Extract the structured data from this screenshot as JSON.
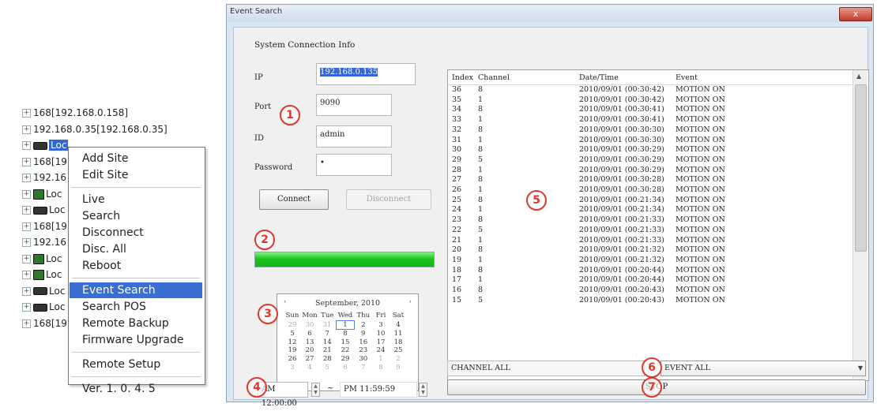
{
  "tree": {
    "items": [
      {
        "label": "168[192.168.0.158]",
        "icon": "none"
      },
      {
        "label": "192.168.0.35[192.168.0.35]",
        "icon": "none"
      },
      {
        "label": "Loc",
        "icon": "dvr"
      },
      {
        "label": "168[19",
        "icon": "none"
      },
      {
        "label": "192.16",
        "icon": "none"
      },
      {
        "label": "Loc",
        "icon": "server"
      },
      {
        "label": "Loc",
        "icon": "dvr"
      },
      {
        "label": "168[19",
        "icon": "none"
      },
      {
        "label": "192.16",
        "icon": "none"
      },
      {
        "label": "Loc",
        "icon": "server"
      },
      {
        "label": "Loc",
        "icon": "server"
      },
      {
        "label": "Loc",
        "icon": "dvr"
      },
      {
        "label": "Loc",
        "icon": "dvr"
      },
      {
        "label": "168[19",
        "icon": "none"
      }
    ]
  },
  "context_menu": {
    "group1": [
      "Add Site",
      "Edit Site"
    ],
    "group2": [
      "Live",
      "Search",
      "Disconnect",
      "Disc. All",
      "Reboot"
    ],
    "group3": [
      "Event Search",
      "Search POS",
      "Remote Backup",
      "Firmware Upgrade"
    ],
    "group4": [
      "Remote Setup"
    ],
    "group5": [
      "Ver. 1. 0. 4. 5"
    ],
    "highlighted": "Event Search"
  },
  "window": {
    "title": "Event Search",
    "close_glyph": "x"
  },
  "connection": {
    "section_title": "System Connection Info",
    "ip_label": "IP",
    "ip_value": "192.168.0.135",
    "port_label": "Port",
    "port_value": "9090",
    "id_label": "ID",
    "id_value": "admin",
    "password_label": "Password",
    "password_value": "•",
    "connect_label": "Connect",
    "disconnect_label": "Disconnect"
  },
  "progress": {
    "fraction": 1.0
  },
  "calendar": {
    "month_title": "September, 2010",
    "prev_glyph": "‹",
    "next_glyph": "›",
    "weekdays": [
      "Sun",
      "Mon",
      "Tue",
      "Wed",
      "Thu",
      "Fri",
      "Sat"
    ],
    "weeks": [
      [
        "29",
        "30",
        "31",
        "1",
        "2",
        "3",
        "4"
      ],
      [
        "5",
        "6",
        "7",
        "8",
        "9",
        "10",
        "11"
      ],
      [
        "12",
        "13",
        "14",
        "15",
        "16",
        "17",
        "18"
      ],
      [
        "19",
        "20",
        "21",
        "22",
        "23",
        "24",
        "25"
      ],
      [
        "26",
        "27",
        "28",
        "29",
        "30",
        "1",
        "2"
      ],
      [
        "3",
        "4",
        "5",
        "6",
        "7",
        "8",
        "9"
      ]
    ]
  },
  "time_range": {
    "start": "AM 12:00:00",
    "separator": "~",
    "end": "PM 11:59:59"
  },
  "event_list": {
    "columns": [
      "Index",
      "Channel",
      "Date/Time",
      "Event"
    ],
    "rows": [
      [
        "36",
        "8",
        "2010/09/01 (00:30:42)",
        "MOTION ON"
      ],
      [
        "35",
        "1",
        "2010/09/01 (00:30:42)",
        "MOTION ON"
      ],
      [
        "34",
        "8",
        "2010/09/01 (00:30:41)",
        "MOTION ON"
      ],
      [
        "33",
        "1",
        "2010/09/01 (00:30:41)",
        "MOTION ON"
      ],
      [
        "32",
        "8",
        "2010/09/01 (00:30:30)",
        "MOTION ON"
      ],
      [
        "31",
        "1",
        "2010/09/01 (00:30:30)",
        "MOTION ON"
      ],
      [
        "30",
        "8",
        "2010/09/01 (00:30:29)",
        "MOTION ON"
      ],
      [
        "29",
        "5",
        "2010/09/01 (00:30:29)",
        "MOTION ON"
      ],
      [
        "28",
        "1",
        "2010/09/01 (00:30:29)",
        "MOTION ON"
      ],
      [
        "27",
        "8",
        "2010/09/01 (00:30:28)",
        "MOTION ON"
      ],
      [
        "26",
        "1",
        "2010/09/01 (00:30:28)",
        "MOTION ON"
      ],
      [
        "25",
        "8",
        "2010/09/01 (00:21:34)",
        "MOTION ON"
      ],
      [
        "24",
        "1",
        "2010/09/01 (00:21:34)",
        "MOTION ON"
      ],
      [
        "23",
        "8",
        "2010/09/01 (00:21:33)",
        "MOTION ON"
      ],
      [
        "22",
        "5",
        "2010/09/01 (00:21:33)",
        "MOTION ON"
      ],
      [
        "21",
        "1",
        "2010/09/01 (00:21:33)",
        "MOTION ON"
      ],
      [
        "20",
        "8",
        "2010/09/01 (00:21:32)",
        "MOTION ON"
      ],
      [
        "19",
        "1",
        "2010/09/01 (00:21:32)",
        "MOTION ON"
      ],
      [
        "18",
        "8",
        "2010/09/01 (00:20:44)",
        "MOTION ON"
      ],
      [
        "17",
        "1",
        "2010/09/01 (00:20:44)",
        "MOTION ON"
      ],
      [
        "16",
        "8",
        "2010/09/01 (00:20:43)",
        "MOTION ON"
      ],
      [
        "15",
        "5",
        "2010/09/01 (00:20:43)",
        "MOTION ON"
      ]
    ]
  },
  "filters": {
    "channel": "CHANNEL ALL",
    "event": "EVENT ALL",
    "stop_label": "STOP"
  },
  "annotations": [
    "1",
    "2",
    "3",
    "4",
    "5",
    "6",
    "7"
  ],
  "colors": {
    "selection": "#3367d6",
    "menu_highlight": "#3b6ed1",
    "progress_green": "#1fc41f",
    "annotation_red": "#e0362b"
  }
}
